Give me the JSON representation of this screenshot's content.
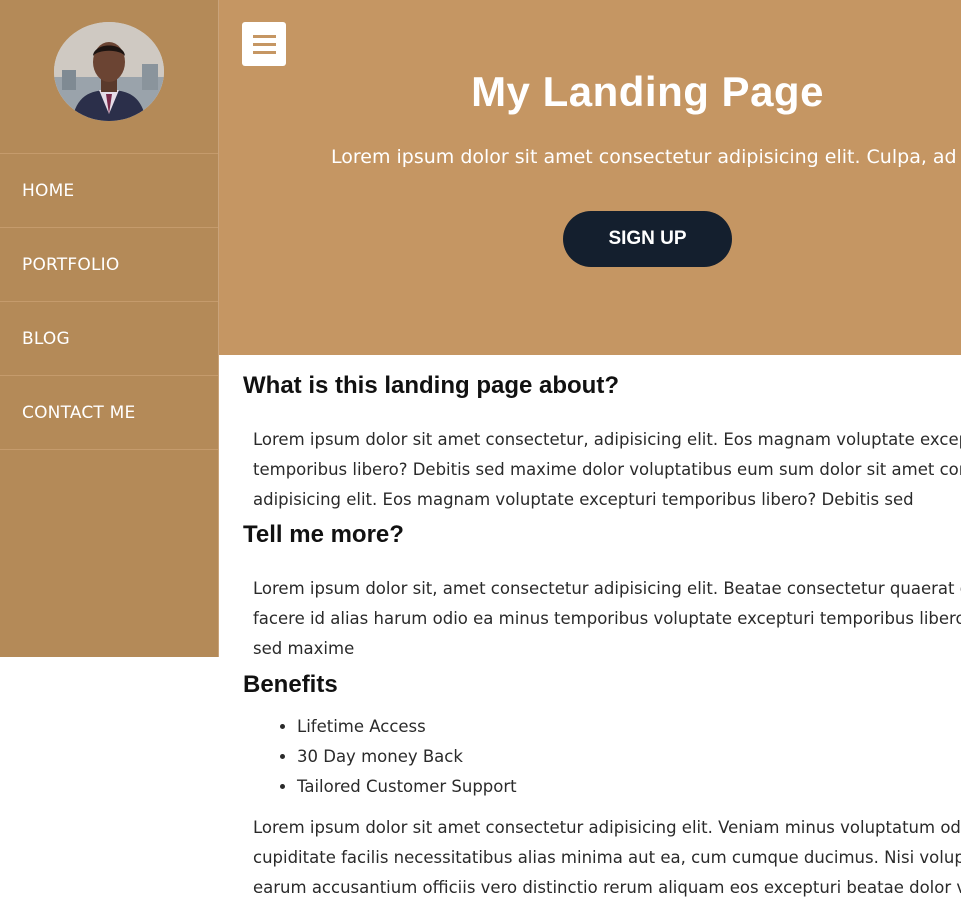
{
  "sidebar": {
    "avatar_icon": "person-portrait",
    "items": [
      {
        "label": "HOME"
      },
      {
        "label": "PORTFOLIO"
      },
      {
        "label": "BLOG"
      },
      {
        "label": "CONTACT ME"
      }
    ]
  },
  "hero": {
    "menu_icon": "hamburger-menu-icon",
    "title": "My Landing Page",
    "subtitle": "Lorem ipsum dolor sit amet consectetur adipisicing elit. Culpa, ad",
    "signup_label": "SIGN UP"
  },
  "content": {
    "section1": {
      "heading": "What is this landing page about?",
      "lines": [
        "Lorem ipsum dolor sit amet consectetur, adipisicing elit. Eos magnam voluptate except",
        "temporibus libero? Debitis sed maxime dolor voluptatibus eum sum dolor sit amet con",
        "adipisicing elit. Eos magnam voluptate excepturi temporibus libero? Debitis sed"
      ]
    },
    "section2": {
      "heading": "Tell me more?",
      "lines": [
        "Lorem ipsum dolor sit, amet consectetur adipisicing elit. Beatae consectetur quaerat qu",
        "facere id alias harum odio ea minus temporibus voluptate excepturi temporibus libero?",
        "sed maxime"
      ]
    },
    "section3": {
      "heading": "Benefits",
      "items": [
        "Lifetime Access",
        "30 Day money Back",
        "Tailored Customer Support"
      ],
      "lines": [
        "Lorem ipsum dolor sit amet consectetur adipisicing elit. Veniam minus voluptatum odio",
        "cupiditate facilis necessitatibus alias minima aut ea, cum cumque ducimus. Nisi volupta",
        "earum accusantium officiis vero distinctio rerum aliquam eos excepturi beatae dolor vol"
      ]
    }
  },
  "colors": {
    "sidebar": "#b48a58",
    "hero": "#c59663",
    "button": "#141f2e"
  }
}
